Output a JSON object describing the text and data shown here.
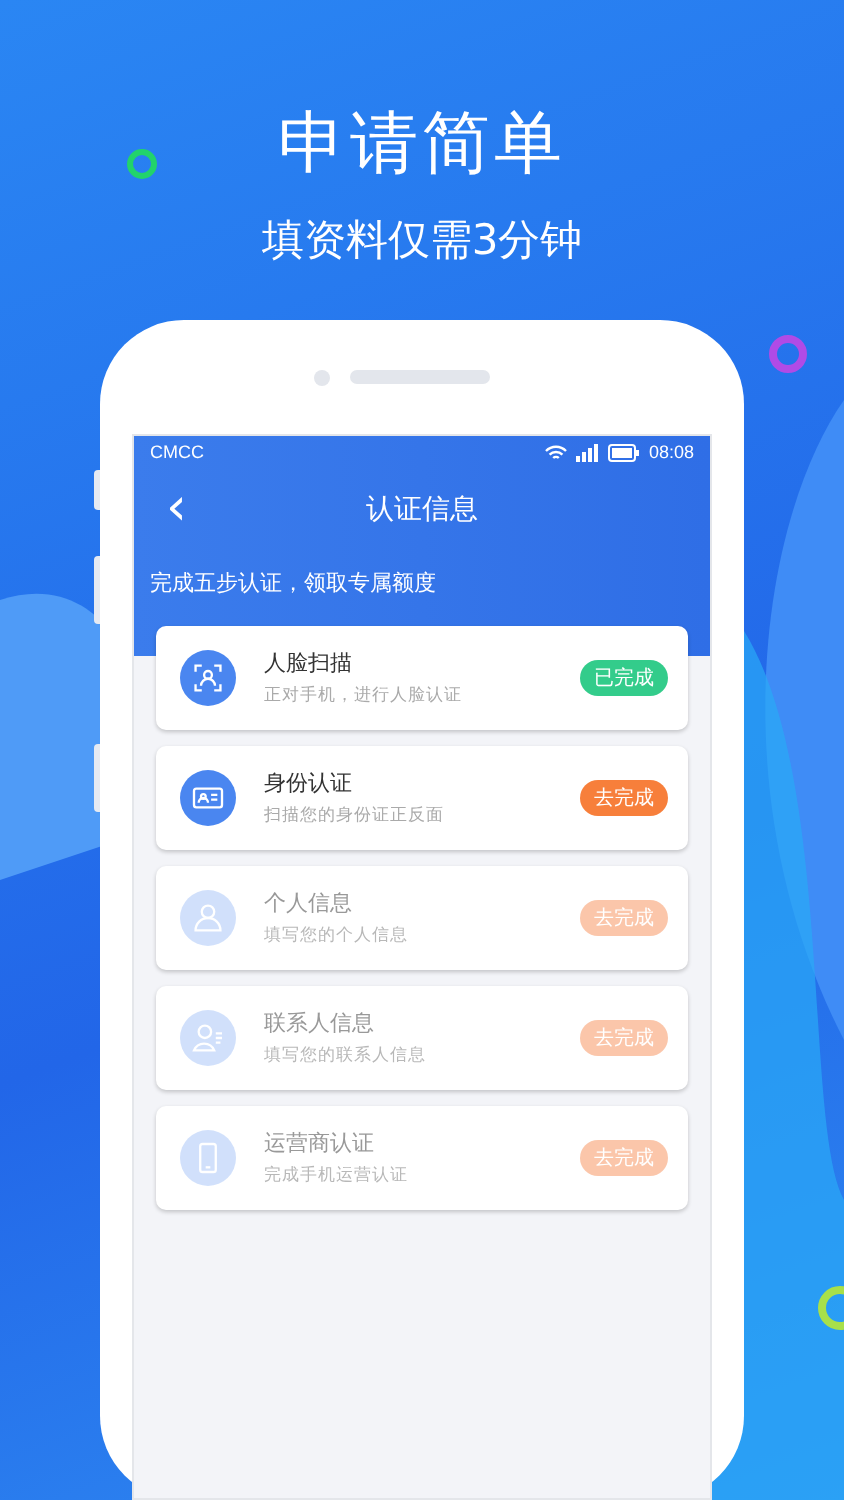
{
  "headline": "申请简单",
  "subheadline": "填资料仅需3分钟",
  "status_bar": {
    "carrier": "CMCC",
    "time": "08:08"
  },
  "nav": {
    "back": "‹",
    "title": "认证信息"
  },
  "banner": "完成五步认证，领取专属额度",
  "steps": [
    {
      "kind": "face",
      "title": "人脸扫描",
      "desc": "正对手机，进行人脸认证",
      "action": "已完成",
      "completed": true,
      "disabled": false
    },
    {
      "kind": "id",
      "title": "身份认证",
      "desc": "扫描您的身份证正反面",
      "action": "去完成",
      "completed": false,
      "disabled": false
    },
    {
      "kind": "person",
      "title": "个人信息",
      "desc": "填写您的个人信息",
      "action": "去完成",
      "completed": false,
      "disabled": true
    },
    {
      "kind": "contact",
      "title": "联系人信息",
      "desc": "填写您的联系人信息",
      "action": "去完成",
      "completed": false,
      "disabled": true
    },
    {
      "kind": "phone",
      "title": "运营商认证",
      "desc": "完成手机运营认证",
      "action": "去完成",
      "completed": false,
      "disabled": true
    }
  ]
}
